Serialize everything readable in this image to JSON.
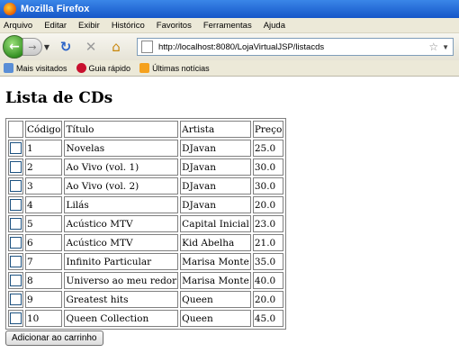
{
  "window": {
    "title": "Mozilla Firefox"
  },
  "menu": [
    "Arquivo",
    "Editar",
    "Exibir",
    "Histórico",
    "Favoritos",
    "Ferramentas",
    "Ajuda"
  ],
  "nav": {
    "url": "http://localhost:8080/LojaVirtualJSP/listacds"
  },
  "bookmarks": [
    "Mais visitados",
    "Guia rápido",
    "Últimas notícias"
  ],
  "page": {
    "heading": "Lista de CDs",
    "columns": [
      "Código",
      "Título",
      "Artista",
      "Preço"
    ],
    "rows": [
      {
        "code": "1",
        "title": "Novelas",
        "artist": "DJavan",
        "price": "25.0"
      },
      {
        "code": "2",
        "title": "Ao Vivo (vol. 1)",
        "artist": "DJavan",
        "price": "30.0"
      },
      {
        "code": "3",
        "title": "Ao Vivo (vol. 2)",
        "artist": "DJavan",
        "price": "30.0"
      },
      {
        "code": "4",
        "title": "Lilás",
        "artist": "DJavan",
        "price": "20.0"
      },
      {
        "code": "5",
        "title": "Acústico MTV",
        "artist": "Capital Inicial",
        "price": "23.0"
      },
      {
        "code": "6",
        "title": "Acústico MTV",
        "artist": "Kid Abelha",
        "price": "21.0"
      },
      {
        "code": "7",
        "title": "Infinito Particular",
        "artist": "Marisa Monte",
        "price": "35.0"
      },
      {
        "code": "8",
        "title": "Universo ao meu redor",
        "artist": "Marisa Monte",
        "price": "40.0"
      },
      {
        "code": "9",
        "title": "Greatest hits",
        "artist": "Queen",
        "price": "20.0"
      },
      {
        "code": "10",
        "title": "Queen Collection",
        "artist": "Queen",
        "price": "45.0"
      }
    ],
    "submit_label": "Adicionar ao carrinho"
  }
}
